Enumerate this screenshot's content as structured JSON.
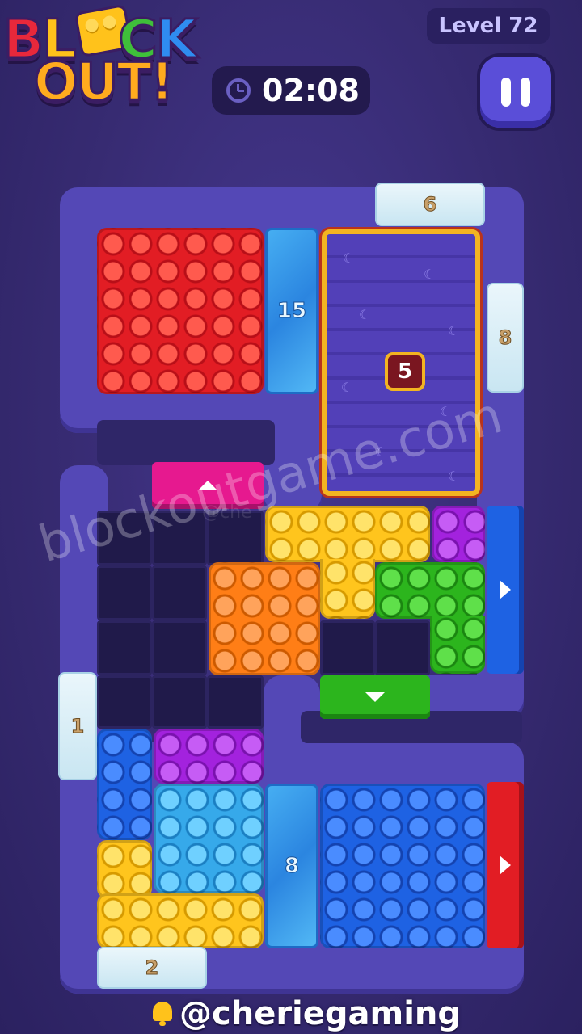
{
  "logo": {
    "line1": [
      "B",
      "L",
      "C",
      "K"
    ],
    "line2": "OUT!"
  },
  "timer": {
    "value": "02:08"
  },
  "level": {
    "label": "Level 72"
  },
  "board": {
    "ice_blocks": {
      "top_counter": "15",
      "bottom_counter": "8"
    },
    "snow_blocks": {
      "top": "6",
      "right": "8",
      "left": "1",
      "bottom": "2"
    },
    "crate": {
      "count": "5"
    }
  },
  "watermark": {
    "site": "blockoutgame.com",
    "partial": "@che"
  },
  "footer": {
    "handle": "@cheriegaming"
  },
  "colors": {
    "red": "#e21d24",
    "yellow": "#ffc51d",
    "orange": "#ff7e16",
    "green": "#2cb51d",
    "purple": "#a322de",
    "blue": "#1e62e3",
    "cyan": "#36a9ea",
    "pink_gate": "#e6198f"
  }
}
